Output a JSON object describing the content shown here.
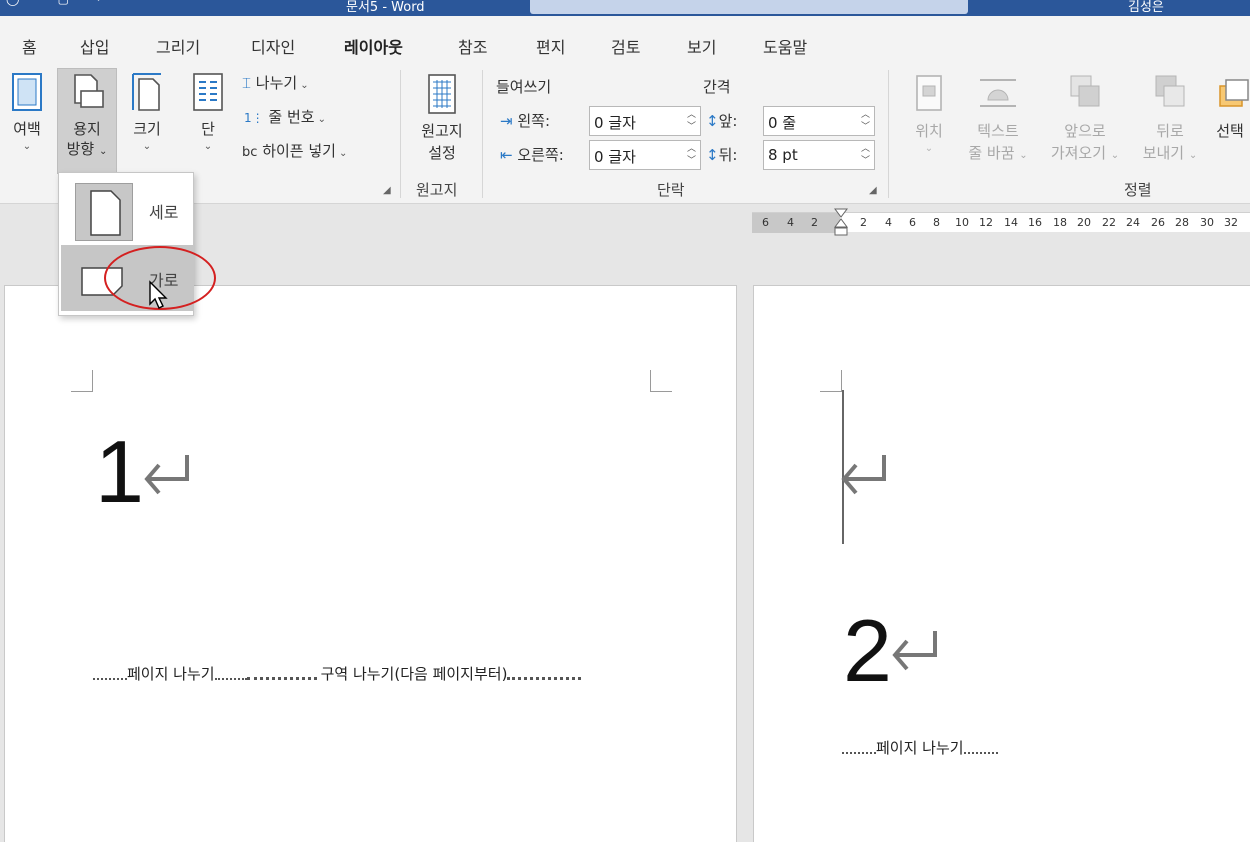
{
  "window": {
    "title": "문서5 - Word",
    "user": "김성은"
  },
  "tabs": [
    "홈",
    "삽입",
    "그리기",
    "디자인",
    "레이아웃",
    "참조",
    "편지",
    "검토",
    "보기",
    "도움말"
  ],
  "active_tab": "레이아웃",
  "ribbon": {
    "page_setup": {
      "margins": "여백",
      "orientation_l1": "용지",
      "orientation_l2": "방향",
      "size": "크기",
      "columns": "단",
      "breaks": "나누기",
      "line_numbers": "줄 번호",
      "hyphenation": "하이픈 넣기"
    },
    "manuscript": {
      "label_l1": "원고지",
      "label_l2": "설정",
      "group": "원고지"
    },
    "paragraph": {
      "indent_title": "들여쓰기",
      "spacing_title": "간격",
      "left_label": "왼쪽:",
      "left_value": "0 글자",
      "right_label": "오른쪽:",
      "right_value": "0 글자",
      "before_label": "앞:",
      "before_value": "0 줄",
      "after_label": "뒤:",
      "after_value": "8 pt",
      "group": "단락"
    },
    "arrange": {
      "position": "위치",
      "wrap_l1": "텍스트",
      "wrap_l2": "줄 바꿈",
      "forward_l1": "앞으로",
      "forward_l2": "가져오기",
      "backward_l1": "뒤로",
      "backward_l2": "보내기",
      "select": "선택",
      "group": "정렬"
    }
  },
  "orientation_menu": {
    "portrait": "세로",
    "landscape": "가로"
  },
  "ruler": {
    "numbers": [
      "6",
      "4",
      "2",
      "2",
      "4",
      "6",
      "8",
      "10",
      "12",
      "14",
      "16",
      "18",
      "20",
      "22",
      "24",
      "26",
      "28",
      "30",
      "32"
    ]
  },
  "document": {
    "page1_number": "1",
    "page2_number": "2",
    "page_break": "페이지 나누기",
    "section_break": "구역 나누기(다음 페이지부터)",
    "page_break_2": "페이지 나누기"
  }
}
